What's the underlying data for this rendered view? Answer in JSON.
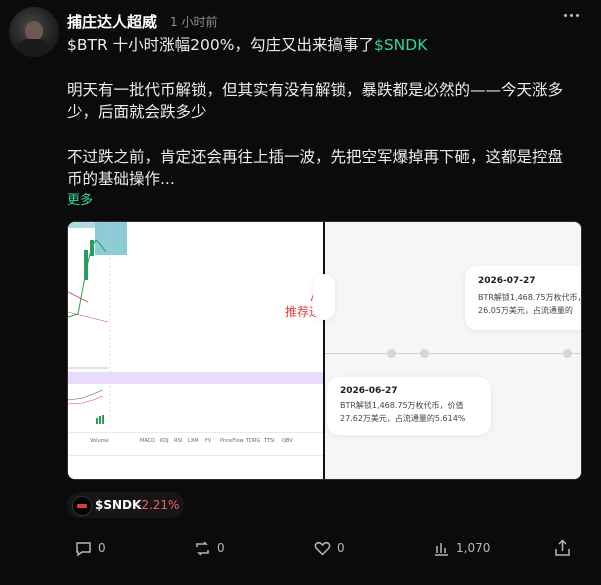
{
  "post": {
    "author": "捕庄达人超威",
    "time": "1 小时前",
    "line1_a": "$BTR 十小时涨幅200%，勾庄又出来搞事了",
    "line1_cashtag": "$SNDK",
    "para2_line1": "明天有一批代币解锁，但其实有没有解锁，暴跌都是必然的——今天涨多",
    "para2_line2": "少，后面就会跌多少",
    "para3_line1": "不过跌之前，肯定还会再往上插一波，先把空军爆掉再下砸，这都是控盘",
    "para3_line2": "币的基础操作...",
    "more": "更多"
  },
  "media": {
    "left_chart": {
      "annotation": "推荐进",
      "tiny_labels": [
        "Volume",
        "MACD",
        "KDJ",
        "RSI",
        "LXM",
        "FV",
        "PriceFlow",
        "TDRG",
        "TTSI",
        "OBV"
      ]
    },
    "right_panel": {
      "card_top": {
        "date": "2026-07-27",
        "text1": "BTR解锁1,468.75万枚代币，",
        "text2": "26.05万美元，占流通量的"
      },
      "card_bottom": {
        "date": "2026-06-27",
        "text1": "BTR解锁1,468.75万枚代币，价值",
        "text2": "27.62万美元，占流通量的5.614%"
      }
    }
  },
  "tag": {
    "symbol": "$SNDK",
    "change": "-2.21%",
    "change_color": "#f0616d"
  },
  "actions": {
    "comments": "0",
    "reposts": "0",
    "likes": "0",
    "views": "1,070"
  },
  "colors": {
    "accent": "#39d7a6",
    "background": "#0b0b0b"
  }
}
